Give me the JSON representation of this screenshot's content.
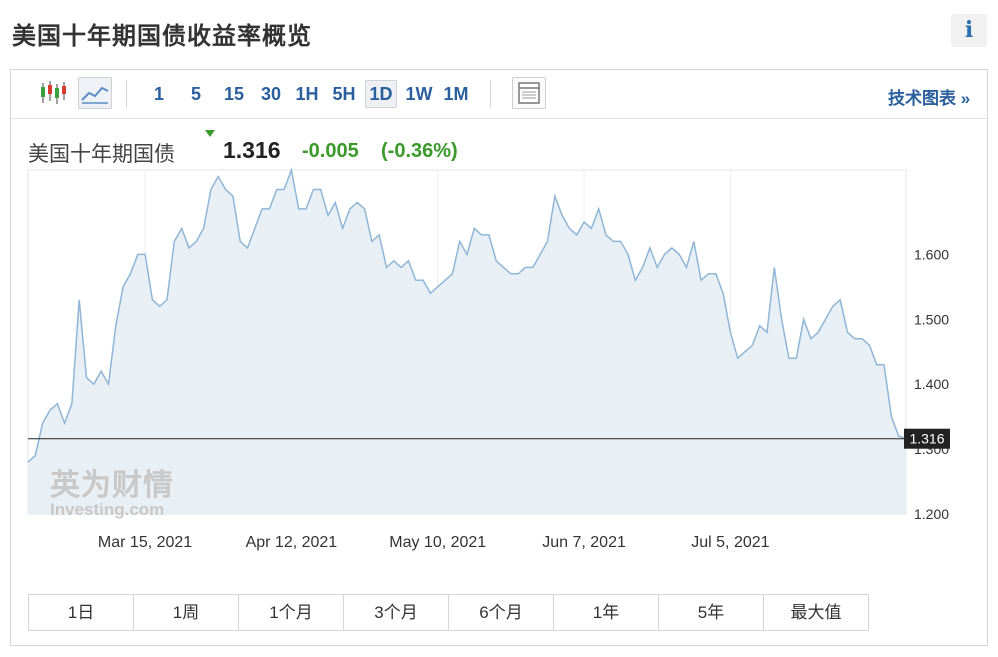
{
  "page": {
    "title": "美国十年期国债收益率概览",
    "info_icon": "i"
  },
  "toolbar": {
    "timeframes": [
      "1",
      "5",
      "15",
      "30",
      "1H",
      "5H",
      "1D",
      "1W",
      "1M"
    ],
    "active_timeframe": "1D",
    "tech_chart_link": "技术图表 »"
  },
  "quote": {
    "name": "美国十年期国债",
    "price": "1.316",
    "change": "-0.005",
    "change_pct": "(-0.36%)",
    "up_color": "#3a9a2a"
  },
  "watermark": {
    "cn": "英为财情",
    "en": "Investing.com"
  },
  "ranges": [
    "1日",
    "1周",
    "1个月",
    "3个月",
    "6个月",
    "1年",
    "5年",
    "最大值"
  ],
  "chart_data": {
    "type": "area",
    "x_tick_labels": [
      "Mar 15, 2021",
      "Apr 12, 2021",
      "May 10, 2021",
      "Jun 7, 2021",
      "Jul 5, 2021"
    ],
    "x_tick_index": [
      16,
      36,
      56,
      76,
      96
    ],
    "y_tick_labels": [
      "1.600",
      "1.500",
      "1.400",
      "1.300",
      "1.200"
    ],
    "y_ticks": [
      1.6,
      1.5,
      1.4,
      1.3,
      1.2
    ],
    "ylim": [
      1.2,
      1.73
    ],
    "current_value": 1.316,
    "current_label": "1.316",
    "line_color": "#8fb6d6",
    "fill_color": "#e8eff5",
    "values": [
      1.28,
      1.29,
      1.34,
      1.36,
      1.37,
      1.34,
      1.37,
      1.53,
      1.41,
      1.4,
      1.42,
      1.4,
      1.49,
      1.55,
      1.57,
      1.6,
      1.6,
      1.53,
      1.52,
      1.53,
      1.62,
      1.64,
      1.61,
      1.62,
      1.64,
      1.7,
      1.72,
      1.7,
      1.69,
      1.62,
      1.61,
      1.64,
      1.67,
      1.67,
      1.7,
      1.7,
      1.73,
      1.67,
      1.67,
      1.7,
      1.7,
      1.66,
      1.68,
      1.64,
      1.67,
      1.68,
      1.67,
      1.62,
      1.63,
      1.58,
      1.59,
      1.58,
      1.59,
      1.56,
      1.56,
      1.54,
      1.55,
      1.56,
      1.57,
      1.62,
      1.6,
      1.64,
      1.63,
      1.63,
      1.59,
      1.58,
      1.57,
      1.57,
      1.58,
      1.58,
      1.6,
      1.62,
      1.69,
      1.66,
      1.64,
      1.63,
      1.65,
      1.64,
      1.67,
      1.63,
      1.62,
      1.62,
      1.6,
      1.56,
      1.58,
      1.61,
      1.58,
      1.6,
      1.61,
      1.6,
      1.58,
      1.62,
      1.56,
      1.57,
      1.57,
      1.54,
      1.48,
      1.44,
      1.45,
      1.46,
      1.49,
      1.48,
      1.58,
      1.5,
      1.44,
      1.44,
      1.5,
      1.47,
      1.48,
      1.5,
      1.52,
      1.53,
      1.48,
      1.47,
      1.47,
      1.46,
      1.43,
      1.43,
      1.35,
      1.32,
      1.316
    ]
  }
}
